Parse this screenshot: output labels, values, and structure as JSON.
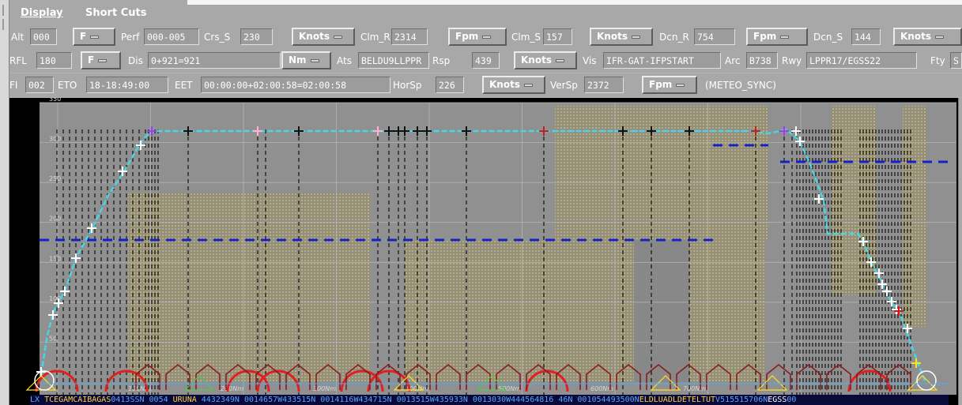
{
  "menu": {
    "display": "Display",
    "shortcuts": "Short Cuts"
  },
  "row1": {
    "alt_label": "Alt",
    "alt_value": "000",
    "alt_unit": "F",
    "perf_label": "Perf",
    "perf_value": "000-005",
    "crs_s_label": "Crs_S",
    "crs_s_value": "230",
    "crs_unit": "Knots",
    "clm_r_label": "Clm_R",
    "clm_r_value": "2314",
    "clm_r_unit": "Fpm",
    "clm_s_label": "Clm_S",
    "clm_s_value": "157",
    "clm_s_unit": "Knots",
    "dcn_r_label": "Dcn_R",
    "dcn_r_value": "754",
    "dcn_r_unit": "Fpm",
    "dcn_s_label": "Dcn_S",
    "dcn_s_value": "144",
    "dcn_s_unit": "Knots"
  },
  "row2": {
    "rfl_label": "RFL",
    "rfl_value": "180",
    "rfl_unit": "F",
    "dis_label": "Dis",
    "dis_value": "0+921=921",
    "dis_unit": "Nm",
    "ats_label": "Ats",
    "ats_value": "BELDU9LLPPR",
    "rsp_label": "Rsp",
    "rsp_value": "439",
    "rsp_unit": "Knots",
    "vis_label": "Vis",
    "vis_value": "IFR-GAT-IFPSTART",
    "arc_label": "Arc",
    "arc_value": "B738",
    "rwy_label": "Rwy",
    "rwy_value": "LPPR17/EGSS22",
    "fty_label": "Fty",
    "fty_value": "S"
  },
  "row3": {
    "fi_label": "FI",
    "fi_value": "002",
    "eto_label": "ETO",
    "eto_value": "18-18:49:00",
    "eet_label": "EET",
    "eet_value": "00:00:00+02:00:58=02:00:58",
    "horsp_label": "HorSp",
    "horsp_value": "226",
    "horsp_unit": "Knots",
    "versp_label": "VerSp",
    "versp_value": "2372",
    "versp_unit": "Fpm",
    "meteo": "(METEO_SYNC)"
  },
  "chart_data": {
    "type": "line",
    "ylim": [
      0,
      350
    ],
    "y_ticks": [
      "350",
      "300",
      "250",
      "200",
      "150",
      "100",
      "50"
    ],
    "x_ticks": [
      "100Nm",
      "200Nm",
      "300Nm",
      "400Nm",
      "500Nm",
      "600Nm",
      "700Nm"
    ],
    "series": [
      {
        "values": [
          [
            0,
            10
          ],
          [
            5,
            30
          ],
          [
            10,
            60
          ],
          [
            20,
            100
          ],
          [
            35,
            170
          ],
          [
            50,
            220
          ],
          [
            65,
            280
          ],
          [
            80,
            320
          ],
          [
            900,
            320
          ],
          [
            915,
            290
          ],
          [
            940,
            230
          ],
          [
            960,
            185
          ],
          [
            1000,
            185
          ],
          [
            1030,
            140
          ],
          [
            1050,
            100
          ],
          [
            1080,
            60
          ],
          [
            1100,
            20
          ]
        ]
      }
    ],
    "rfl_line": 180,
    "colors": {
      "profile": "#46d6e6",
      "rfl": "#1420c8",
      "restricted": "#c8b04a",
      "background": "#909090"
    }
  },
  "waypoints_strip": {
    "segments": [
      {
        "t": "LX ",
        "c": "b"
      },
      {
        "t": "TCEGAM",
        "c": "y"
      },
      {
        "t": "CAIBAGAS",
        "c": "y"
      },
      {
        "t": "0413",
        "c": "b"
      },
      {
        "t": "SSN",
        "c": "b"
      },
      {
        "t": " 0054 ",
        "c": "b"
      },
      {
        "t": "URUNA",
        "c": "y"
      },
      {
        "t": " 4432349N ",
        "c": "b"
      },
      {
        "t": "0014657W433515N ",
        "c": "b"
      },
      {
        "t": "0014116W434715N ",
        "c": "b"
      },
      {
        "t": "0013515W435933N ",
        "c": "b"
      },
      {
        "t": "0013030W444564816 46N ",
        "c": "b"
      },
      {
        "t": "0010544",
        "c": "b"
      },
      {
        "t": "93500N",
        "c": "b"
      },
      {
        "t": "ELDLU",
        "c": "y"
      },
      {
        "t": "ADLDETELTUT",
        "c": "y"
      },
      {
        "t": "V515515706N",
        "c": "b"
      },
      {
        "t": "EGSS",
        "c": "w"
      },
      {
        "t": "00",
        "c": "b"
      }
    ]
  }
}
